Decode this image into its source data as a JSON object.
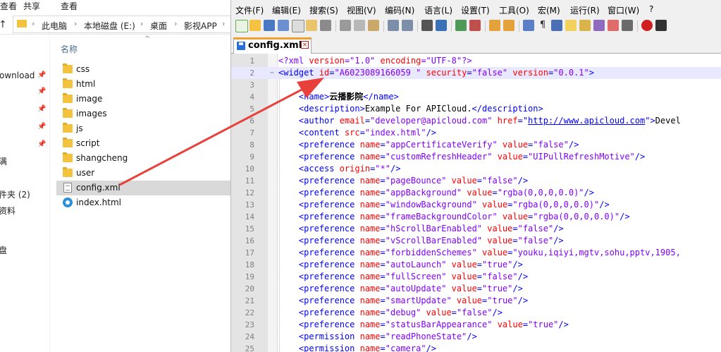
{
  "explorer": {
    "ribbon_tabs": [
      "查看",
      "共享",
      "查看"
    ],
    "address": {
      "crumbs": [
        "此电脑",
        "本地磁盘 (E:)",
        "桌面",
        "影视APP"
      ]
    },
    "nav_items": [
      "ownload",
      "满",
      "件夹 (2)",
      "资料",
      "盘"
    ],
    "column_header": "名称",
    "files": [
      {
        "name": "css",
        "type": "folder"
      },
      {
        "name": "html",
        "type": "folder"
      },
      {
        "name": "image",
        "type": "folder"
      },
      {
        "name": "images",
        "type": "folder"
      },
      {
        "name": "js",
        "type": "folder"
      },
      {
        "name": "script",
        "type": "folder"
      },
      {
        "name": "shangcheng",
        "type": "folder"
      },
      {
        "name": "user",
        "type": "folder"
      },
      {
        "name": "config.xml",
        "type": "xml",
        "selected": true
      },
      {
        "name": "index.html",
        "type": "html"
      }
    ]
  },
  "editor_app": {
    "menu": [
      "文件(F)",
      "编辑(E)",
      "搜索(S)",
      "视图(V)",
      "编码(N)",
      "语言(L)",
      "设置(T)",
      "工具(O)",
      "宏(M)",
      "运行(R)",
      "窗口(W)",
      "?"
    ],
    "tab": {
      "label": "config.xml",
      "close_icon": "×"
    },
    "fold_markers": {
      "line2": "−"
    },
    "lines": [
      {
        "n": "1",
        "segs": [
          [
            "pi",
            "<?xml "
          ],
          [
            "attr",
            "version"
          ],
          [
            "pi",
            "=\"1.0\" "
          ],
          [
            "attr",
            "encoding"
          ],
          [
            "pi",
            "=\"UTF-8\"?>"
          ]
        ]
      },
      {
        "n": "2",
        "current": true,
        "segs": [
          [
            "tag",
            "<widget "
          ],
          [
            "attr",
            "id"
          ],
          [
            "tag",
            "="
          ],
          [
            "val",
            "\"A6023089166059 \" "
          ],
          [
            "attr",
            "security"
          ],
          [
            "tag",
            "="
          ],
          [
            "val",
            "\"false\" "
          ],
          [
            "attr",
            "version"
          ],
          [
            "tag",
            "="
          ],
          [
            "val",
            "\"0.0.1\""
          ],
          [
            "tag",
            ">"
          ]
        ]
      },
      {
        "n": "3",
        "segs": []
      },
      {
        "n": "4",
        "segs": [
          [
            "txt",
            "    "
          ],
          [
            "tag",
            "<name>"
          ],
          [
            "txt",
            "云播影院"
          ],
          [
            "tag",
            "</name>"
          ]
        ]
      },
      {
        "n": "5",
        "segs": [
          [
            "txt",
            "    "
          ],
          [
            "tag",
            "<description>"
          ],
          [
            "plain",
            "Example For APICloud."
          ],
          [
            "tag",
            "</description>"
          ]
        ]
      },
      {
        "n": "6",
        "segs": [
          [
            "txt",
            "    "
          ],
          [
            "tag",
            "<author "
          ],
          [
            "attr",
            "email"
          ],
          [
            "tag",
            "="
          ],
          [
            "val",
            "\"developer@apicloud.com\" "
          ],
          [
            "attr",
            "href"
          ],
          [
            "tag",
            "=\""
          ],
          [
            "lnk",
            "http://www.apicloud.com"
          ],
          [
            "tag",
            "\">"
          ],
          [
            "plain",
            "Devel"
          ]
        ]
      },
      {
        "n": "7",
        "segs": [
          [
            "txt",
            "    "
          ],
          [
            "tag",
            "<content "
          ],
          [
            "attr",
            "src"
          ],
          [
            "tag",
            "="
          ],
          [
            "val",
            "\"index.html\""
          ],
          [
            "tag",
            "/>"
          ]
        ]
      },
      {
        "n": "8",
        "segs": [
          [
            "txt",
            "    "
          ],
          [
            "tag",
            "<preference "
          ],
          [
            "attr",
            "name"
          ],
          [
            "tag",
            "="
          ],
          [
            "val",
            "\"appCertificateVerify\" "
          ],
          [
            "attr",
            "value"
          ],
          [
            "tag",
            "="
          ],
          [
            "val",
            "\"false\""
          ],
          [
            "tag",
            "/>"
          ]
        ]
      },
      {
        "n": "9",
        "segs": [
          [
            "txt",
            "    "
          ],
          [
            "tag",
            "<preference "
          ],
          [
            "attr",
            "name"
          ],
          [
            "tag",
            "="
          ],
          [
            "val",
            "\"customRefreshHeader\" "
          ],
          [
            "attr",
            "value"
          ],
          [
            "tag",
            "="
          ],
          [
            "val",
            "\"UIPullRefreshMotive\""
          ],
          [
            "tag",
            "/>"
          ]
        ]
      },
      {
        "n": "10",
        "segs": [
          [
            "txt",
            "    "
          ],
          [
            "tag",
            "<access "
          ],
          [
            "attr",
            "origin"
          ],
          [
            "tag",
            "="
          ],
          [
            "val",
            "\"*\""
          ],
          [
            "tag",
            "/>"
          ]
        ]
      },
      {
        "n": "11",
        "segs": [
          [
            "txt",
            "    "
          ],
          [
            "tag",
            "<preference "
          ],
          [
            "attr",
            "name"
          ],
          [
            "tag",
            "="
          ],
          [
            "val",
            "\"pageBounce\" "
          ],
          [
            "attr",
            "value"
          ],
          [
            "tag",
            "="
          ],
          [
            "val",
            "\"false\""
          ],
          [
            "tag",
            "/>"
          ]
        ]
      },
      {
        "n": "12",
        "segs": [
          [
            "txt",
            "    "
          ],
          [
            "tag",
            "<preference "
          ],
          [
            "attr",
            "name"
          ],
          [
            "tag",
            "="
          ],
          [
            "val",
            "\"appBackground\" "
          ],
          [
            "attr",
            "value"
          ],
          [
            "tag",
            "="
          ],
          [
            "val",
            "\"rgba(0,0,0,0.0)\""
          ],
          [
            "tag",
            "/>"
          ]
        ]
      },
      {
        "n": "13",
        "segs": [
          [
            "txt",
            "    "
          ],
          [
            "tag",
            "<preference "
          ],
          [
            "attr",
            "name"
          ],
          [
            "tag",
            "="
          ],
          [
            "val",
            "\"windowBackground\" "
          ],
          [
            "attr",
            "value"
          ],
          [
            "tag",
            "="
          ],
          [
            "val",
            "\"rgba(0,0,0,0.0)\""
          ],
          [
            "tag",
            "/>"
          ]
        ]
      },
      {
        "n": "14",
        "segs": [
          [
            "txt",
            "    "
          ],
          [
            "tag",
            "<preference "
          ],
          [
            "attr",
            "name"
          ],
          [
            "tag",
            "="
          ],
          [
            "val",
            "\"frameBackgroundColor\" "
          ],
          [
            "attr",
            "value"
          ],
          [
            "tag",
            "="
          ],
          [
            "val",
            "\"rgba(0,0,0,0.0)\""
          ],
          [
            "tag",
            "/>"
          ]
        ]
      },
      {
        "n": "15",
        "segs": [
          [
            "txt",
            "    "
          ],
          [
            "tag",
            "<preference "
          ],
          [
            "attr",
            "name"
          ],
          [
            "tag",
            "="
          ],
          [
            "val",
            "\"hScrollBarEnabled\" "
          ],
          [
            "attr",
            "value"
          ],
          [
            "tag",
            "="
          ],
          [
            "val",
            "\"false\""
          ],
          [
            "tag",
            "/>"
          ]
        ]
      },
      {
        "n": "16",
        "segs": [
          [
            "txt",
            "    "
          ],
          [
            "tag",
            "<preference "
          ],
          [
            "attr",
            "name"
          ],
          [
            "tag",
            "="
          ],
          [
            "val",
            "\"vScrollBarEnabled\" "
          ],
          [
            "attr",
            "value"
          ],
          [
            "tag",
            "="
          ],
          [
            "val",
            "\"false\""
          ],
          [
            "tag",
            "/>"
          ]
        ]
      },
      {
        "n": "17",
        "segs": [
          [
            "txt",
            "    "
          ],
          [
            "tag",
            "<preference "
          ],
          [
            "attr",
            "name"
          ],
          [
            "tag",
            "="
          ],
          [
            "val",
            "\"forbiddenSchemes\" "
          ],
          [
            "attr",
            "value"
          ],
          [
            "tag",
            "="
          ],
          [
            "val",
            "\"youku,iqiyi,mgtv,sohu,pptv,1905,"
          ]
        ]
      },
      {
        "n": "18",
        "segs": [
          [
            "txt",
            "    "
          ],
          [
            "tag",
            "<preference "
          ],
          [
            "attr",
            "name"
          ],
          [
            "tag",
            "="
          ],
          [
            "val",
            "\"autoLaunch\" "
          ],
          [
            "attr",
            "value"
          ],
          [
            "tag",
            "="
          ],
          [
            "val",
            "\"true\""
          ],
          [
            "tag",
            "/>"
          ]
        ]
      },
      {
        "n": "19",
        "segs": [
          [
            "txt",
            "    "
          ],
          [
            "tag",
            "<preference "
          ],
          [
            "attr",
            "name"
          ],
          [
            "tag",
            "="
          ],
          [
            "val",
            "\"fullScreen\" "
          ],
          [
            "attr",
            "value"
          ],
          [
            "tag",
            "="
          ],
          [
            "val",
            "\"false\""
          ],
          [
            "tag",
            "/>"
          ]
        ]
      },
      {
        "n": "20",
        "segs": [
          [
            "txt",
            "    "
          ],
          [
            "tag",
            "<preference "
          ],
          [
            "attr",
            "name"
          ],
          [
            "tag",
            "="
          ],
          [
            "val",
            "\"autoUpdate\" "
          ],
          [
            "attr",
            "value"
          ],
          [
            "tag",
            "="
          ],
          [
            "val",
            "\"true\""
          ],
          [
            "tag",
            "/>"
          ]
        ]
      },
      {
        "n": "21",
        "segs": [
          [
            "txt",
            "    "
          ],
          [
            "tag",
            "<preference "
          ],
          [
            "attr",
            "name"
          ],
          [
            "tag",
            "="
          ],
          [
            "val",
            "\"smartUpdate\" "
          ],
          [
            "attr",
            "value"
          ],
          [
            "tag",
            "="
          ],
          [
            "val",
            "\"true\""
          ],
          [
            "tag",
            "/>"
          ]
        ]
      },
      {
        "n": "22",
        "segs": [
          [
            "txt",
            "    "
          ],
          [
            "tag",
            "<preference "
          ],
          [
            "attr",
            "name"
          ],
          [
            "tag",
            "="
          ],
          [
            "val",
            "\"debug\" "
          ],
          [
            "attr",
            "value"
          ],
          [
            "tag",
            "="
          ],
          [
            "val",
            "\"false\""
          ],
          [
            "tag",
            "/>"
          ]
        ]
      },
      {
        "n": "23",
        "segs": [
          [
            "txt",
            "    "
          ],
          [
            "tag",
            "<preference "
          ],
          [
            "attr",
            "name"
          ],
          [
            "tag",
            "="
          ],
          [
            "val",
            "\"statusBarAppearance\" "
          ],
          [
            "attr",
            "value"
          ],
          [
            "tag",
            "="
          ],
          [
            "val",
            "\"true\""
          ],
          [
            "tag",
            "/>"
          ]
        ]
      },
      {
        "n": "24",
        "segs": [
          [
            "txt",
            "    "
          ],
          [
            "tag",
            "<permission "
          ],
          [
            "attr",
            "name"
          ],
          [
            "tag",
            "="
          ],
          [
            "val",
            "\"readPhoneState\""
          ],
          [
            "tag",
            "/>"
          ]
        ]
      },
      {
        "n": "25",
        "segs": [
          [
            "txt",
            "    "
          ],
          [
            "tag",
            "<permission "
          ],
          [
            "attr",
            "name"
          ],
          [
            "tag",
            "="
          ],
          [
            "val",
            "\"camera\""
          ],
          [
            "tag",
            "/>"
          ]
        ]
      }
    ]
  },
  "colors": {
    "annotation_arrow": "#e8403a",
    "tab_accent": "#f0a030",
    "selection": "#d9d9d9"
  },
  "icons": {
    "up": "↑",
    "breadcrumb_sep": "›",
    "pin": "📌",
    "sort": "^"
  }
}
